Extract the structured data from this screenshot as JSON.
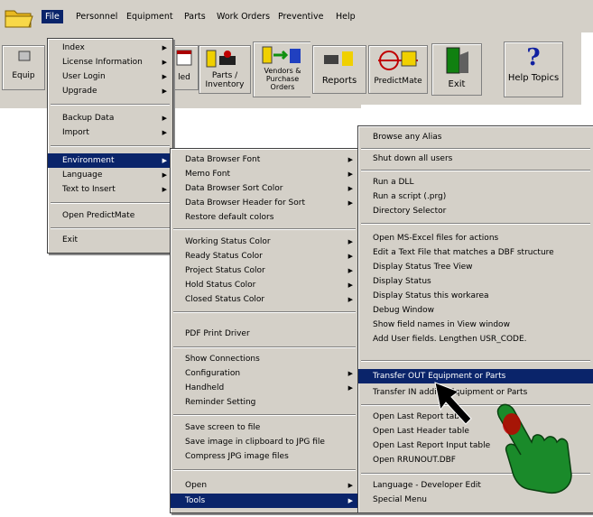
{
  "menubar": {
    "items": [
      "File",
      "Personnel",
      "Equipment",
      "Parts",
      "Work Orders",
      "Preventive",
      "Help"
    ],
    "active_index": 0
  },
  "toolbar": {
    "buttons": [
      {
        "label": "Equip",
        "icon": "wrench-icon"
      },
      {
        "label": "led",
        "icon": "calendar-icon"
      },
      {
        "label": "Parts / Inventory",
        "icon": "parts-icon"
      },
      {
        "label": "Vendors & Purchase Orders",
        "icon": "vendors-icon"
      },
      {
        "label": "Reports",
        "icon": "reports-icon"
      },
      {
        "label": "PredictMate",
        "icon": "predictmate-icon"
      },
      {
        "label": "Exit",
        "icon": "exit-door-icon"
      },
      {
        "label": "Help Topics",
        "icon": "help-icon"
      }
    ],
    "help_glyph": "?"
  },
  "file_menu": {
    "items": [
      {
        "label": "Index",
        "submenu": true
      },
      {
        "label": "License Information",
        "submenu": true
      },
      {
        "label": "User Login",
        "submenu": true
      },
      {
        "label": "Upgrade",
        "submenu": true
      },
      {
        "label": "Backup Data",
        "submenu": true
      },
      {
        "label": "Import",
        "submenu": true
      },
      {
        "label": "Environment",
        "submenu": true,
        "highlighted": true
      },
      {
        "label": "Language",
        "submenu": true
      },
      {
        "label": "Text to Insert",
        "submenu": true
      },
      {
        "label": "Open PredictMate",
        "submenu": false
      },
      {
        "label": "Exit",
        "submenu": false
      }
    ]
  },
  "environment_menu": {
    "items": [
      {
        "label": "Data Browser Font",
        "submenu": true
      },
      {
        "label": "Memo Font",
        "submenu": true
      },
      {
        "label": "Data Browser Sort Color",
        "submenu": true
      },
      {
        "label": "Data Browser Header for Sort",
        "submenu": true
      },
      {
        "label": "Restore default colors",
        "submenu": false
      },
      {
        "label": "Working Status Color",
        "submenu": true
      },
      {
        "label": "Ready Status Color",
        "submenu": true
      },
      {
        "label": "Project Status Color",
        "submenu": true
      },
      {
        "label": "Hold Status Color",
        "submenu": true
      },
      {
        "label": "Closed Status Color",
        "submenu": true
      },
      {
        "label": "PDF Print Driver",
        "submenu": false
      },
      {
        "label": "Show Connections",
        "submenu": false
      },
      {
        "label": "Configuration",
        "submenu": true
      },
      {
        "label": "Handheld",
        "submenu": true
      },
      {
        "label": "Reminder Setting",
        "submenu": false
      },
      {
        "label": "Save screen to file",
        "submenu": false
      },
      {
        "label": "Save image in clipboard to JPG file",
        "submenu": false
      },
      {
        "label": "Compress JPG image files",
        "submenu": false
      },
      {
        "label": "Open",
        "submenu": true
      },
      {
        "label": "Tools",
        "submenu": true,
        "highlighted": true
      }
    ]
  },
  "tools_menu": {
    "items": [
      {
        "label": "Browse any Alias"
      },
      {
        "label": "Shut down all users"
      },
      {
        "label": "Run a DLL"
      },
      {
        "label": "Run a script (.prg)"
      },
      {
        "label": "Directory Selector"
      },
      {
        "label": "Open MS-Excel files for actions"
      },
      {
        "label": "Edit a Text File that matches a DBF structure"
      },
      {
        "label": "Display Status Tree View"
      },
      {
        "label": "Display Status"
      },
      {
        "label": "Display Status this workarea"
      },
      {
        "label": "Debug Window"
      },
      {
        "label": "Show field names in View window"
      },
      {
        "label": "Add User fields. Lengthen USR_CODE."
      },
      {
        "label": "Transfer OUT Equipment or Parts",
        "highlighted": true
      },
      {
        "label": "Transfer IN adding Equipment or Parts"
      },
      {
        "label": "Open Last Report table"
      },
      {
        "label": "Open Last Header table"
      },
      {
        "label": "Open Last Report Input table"
      },
      {
        "label": "Open RRUNOUT.DBF"
      },
      {
        "label": "Language - Developer Edit"
      },
      {
        "label": "Special Menu"
      }
    ]
  },
  "colors": {
    "menu_bg": "#d4d0c8",
    "highlight": "#0a246a",
    "hand": "#1a8a2a"
  }
}
